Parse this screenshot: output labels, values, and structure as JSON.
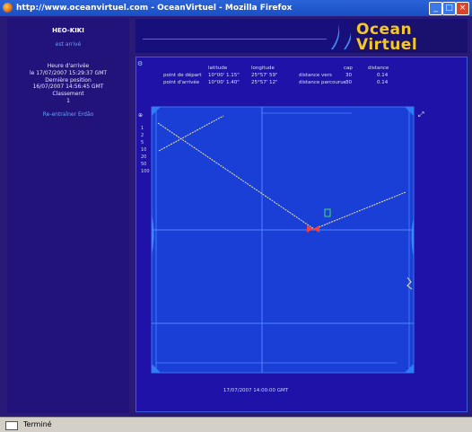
{
  "browser": {
    "title": "http://www.oceanvirtuel.com - OceanVirtuel - Mozilla Firefox",
    "status": "Terminé"
  },
  "sidebar": {
    "boat_name": "HEO-KIKI",
    "arrived": "est arrivé",
    "info_lines": [
      "Heure d'arrivée",
      "le 17/07/2007 15:29:37 GMT",
      "Dernière position",
      "16/07/2007 14:56:45 GMT",
      "Classement",
      "1"
    ],
    "link": "Re-entraîner Erdão"
  },
  "logo": {
    "line1": "Ocean",
    "line2": "Virtuel"
  },
  "position_table": {
    "col_headers": [
      "latitude",
      "longitude",
      "cap",
      "distance"
    ],
    "rows": [
      {
        "label": "point de départ",
        "lat": "10°00' 1.15\"",
        "lon": "25°57' 59\"",
        "label2": "distance vers",
        "cap": "30",
        "dist": "0.14"
      },
      {
        "label": "point d'arrivée",
        "lat": "10°00' 1.40\"",
        "lon": "25°57' 12\"",
        "label2": "distance parcourue",
        "cap": "30",
        "dist": "0.14"
      }
    ]
  },
  "map": {
    "scale_labels": [
      "1",
      "2",
      "5",
      "10",
      "20",
      "50",
      "100"
    ],
    "caption": "17/07/2007 14:00:00 GMT"
  }
}
